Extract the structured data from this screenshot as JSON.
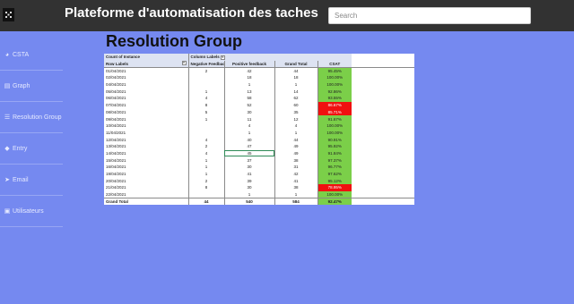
{
  "app": {
    "title": "Plateforme d'automatisation des taches"
  },
  "search": {
    "placeholder": "Search"
  },
  "sidebar": {
    "items": [
      {
        "label": "CSTA",
        "icon": "headset-icon"
      },
      {
        "label": "Graph",
        "icon": "chart-icon"
      },
      {
        "label": "Resolution Group",
        "icon": "list-icon"
      },
      {
        "label": "Entry",
        "icon": "tag-icon"
      },
      {
        "label": "Email",
        "icon": "send-icon"
      },
      {
        "label": "Utilisateurs",
        "icon": "id-card-icon"
      }
    ]
  },
  "page": {
    "title": "Resolution Group"
  },
  "table": {
    "meta_left": "Count of Instance",
    "meta_mid": "Column Labels",
    "headers": [
      "Row Labels",
      "Negative Feedback",
      "Positive feedback",
      "Grand Total",
      "CSAT"
    ],
    "rows": [
      {
        "date": "01/04/2021",
        "neg": "2",
        "pos": "42",
        "total": "44",
        "csat": "95.45%",
        "status": "good"
      },
      {
        "date": "02/04/2021",
        "neg": "",
        "pos": "18",
        "total": "18",
        "csat": "100.00%",
        "status": "good"
      },
      {
        "date": "04/04/2021",
        "neg": "",
        "pos": "1",
        "total": "1",
        "csat": "100.00%",
        "status": "good"
      },
      {
        "date": "05/04/2021",
        "neg": "1",
        "pos": "13",
        "total": "14",
        "csat": "92.86%",
        "status": "good"
      },
      {
        "date": "06/04/2021",
        "neg": "4",
        "pos": "58",
        "total": "62",
        "csat": "93.55%",
        "status": "good"
      },
      {
        "date": "07/04/2021",
        "neg": "8",
        "pos": "52",
        "total": "60",
        "csat": "86.67%",
        "status": "bad"
      },
      {
        "date": "08/04/2021",
        "neg": "5",
        "pos": "30",
        "total": "35",
        "csat": "85.71%",
        "status": "bad"
      },
      {
        "date": "09/04/2021",
        "neg": "1",
        "pos": "11",
        "total": "12",
        "csat": "91.67%",
        "status": "good"
      },
      {
        "date": "10/04/2021",
        "neg": "",
        "pos": "4",
        "total": "4",
        "csat": "100.00%",
        "status": "good"
      },
      {
        "date": "11/04/2021",
        "neg": "",
        "pos": "1",
        "total": "1",
        "csat": "100.00%",
        "status": "good"
      },
      {
        "date": "12/04/2021",
        "neg": "4",
        "pos": "40",
        "total": "44",
        "csat": "90.91%",
        "status": "good"
      },
      {
        "date": "13/04/2021",
        "neg": "2",
        "pos": "47",
        "total": "49",
        "csat": "95.92%",
        "status": "good"
      },
      {
        "date": "14/04/2021",
        "neg": "4",
        "pos": "45",
        "total": "49",
        "csat": "91.84%",
        "status": "good"
      },
      {
        "date": "15/04/2021",
        "neg": "1",
        "pos": "37",
        "total": "38",
        "csat": "97.37%",
        "status": "good"
      },
      {
        "date": "16/04/2021",
        "neg": "1",
        "pos": "30",
        "total": "31",
        "csat": "96.77%",
        "status": "good"
      },
      {
        "date": "19/04/2021",
        "neg": "1",
        "pos": "41",
        "total": "42",
        "csat": "97.62%",
        "status": "good"
      },
      {
        "date": "20/04/2021",
        "neg": "2",
        "pos": "39",
        "total": "41",
        "csat": "95.12%",
        "status": "good"
      },
      {
        "date": "21/04/2021",
        "neg": "8",
        "pos": "30",
        "total": "38",
        "csat": "78.95%",
        "status": "bad"
      },
      {
        "date": "22/04/2021",
        "neg": "",
        "pos": "1",
        "total": "1",
        "csat": "100.00%",
        "status": "good"
      }
    ],
    "total": {
      "label": "Grand Total",
      "neg": "44",
      "pos": "540",
      "total": "584",
      "csat": "92.47%"
    }
  },
  "colors": {
    "topbar": "#323232",
    "background": "#7589f0",
    "csat_good": "#7bcf49",
    "csat_bad": "#f01010"
  }
}
